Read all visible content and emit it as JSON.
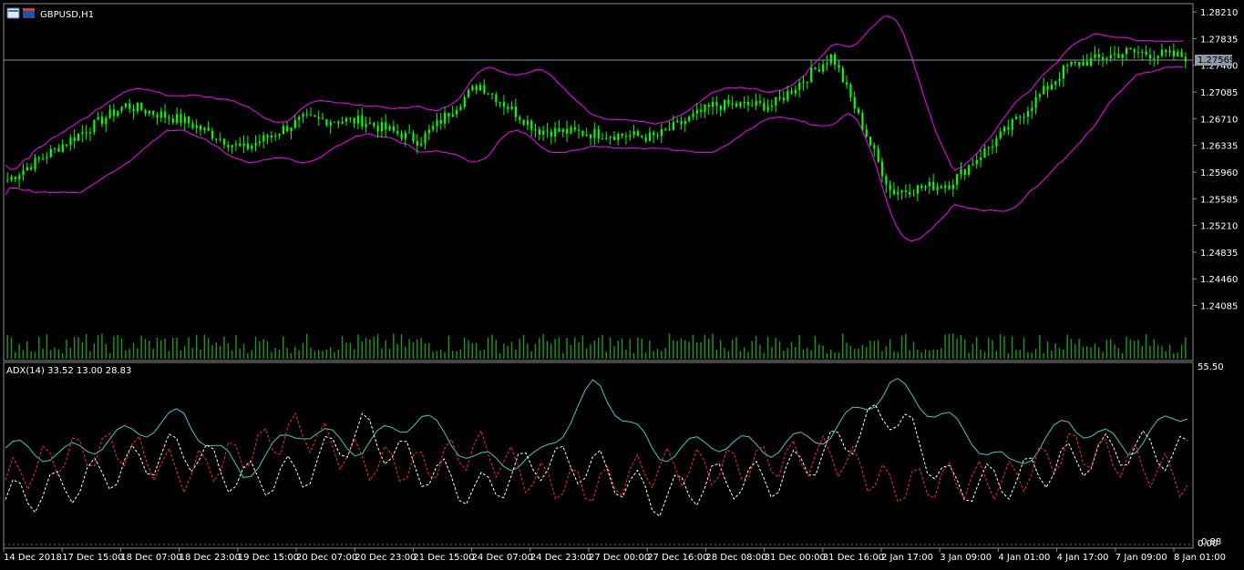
{
  "main_chart": {
    "symbol_label": "GBPUSD,H1",
    "current_price": "1.27569",
    "price_ticks": [
      "1.28210",
      "1.27835",
      "1.27460",
      "1.27085",
      "1.26710",
      "1.26335",
      "1.25960",
      "1.25585",
      "1.25210",
      "1.24835",
      "1.24460",
      "1.24085"
    ]
  },
  "indicator": {
    "label": "ADX(14) 33.52 13.00 28.83",
    "top_label": "55.50",
    "bottom_labels": [
      "0.00",
      "0.88"
    ]
  },
  "time_labels": [
    "14 Dec 2018",
    "17 Dec 15:00",
    "18 Dec 07:00",
    "18 Dec 23:00",
    "19 Dec 15:00",
    "20 Dec 07:00",
    "20 Dec 23:00",
    "21 Dec 15:00",
    "24 Dec 07:00",
    "24 Dec 23:00",
    "27 Dec 00:00",
    "27 Dec 16:00",
    "28 Dec 08:00",
    "31 Dec 00:00",
    "31 Dec 16:00",
    "2 Jan 17:00",
    "3 Jan 09:00",
    "4 Jan 01:00",
    "4 Jan 17:00",
    "7 Jan 09:00",
    "8 Jan 01:00"
  ],
  "colors": {
    "background": "#000000",
    "candle": "#00ff00",
    "bollinger": "#ff00ff",
    "volume": "#1a9a1a",
    "adx": "#40c8c8",
    "plus_di": "#ffffff",
    "minus_di": "#ff2a2a",
    "axis_text": "#ffffff",
    "price_label_bg": "#8c99a6"
  },
  "chart_data": {
    "type": "line",
    "title": "GBPUSD,H1",
    "ylim": [
      1.239,
      1.2825
    ],
    "x": [
      "14 Dec 2018",
      "17 Dec 15:00",
      "18 Dec 07:00",
      "18 Dec 23:00",
      "19 Dec 15:00",
      "20 Dec 07:00",
      "20 Dec 23:00",
      "21 Dec 15:00",
      "24 Dec 07:00",
      "24 Dec 23:00",
      "27 Dec 00:00",
      "27 Dec 16:00",
      "28 Dec 08:00",
      "31 Dec 00:00",
      "31 Dec 16:00",
      "2 Jan 17:00",
      "3 Jan 09:00",
      "4 Jan 01:00",
      "4 Jan 17:00",
      "7 Jan 09:00",
      "8 Jan 01:00"
    ],
    "series": [
      {
        "values": [
          1.2585,
          1.2638,
          1.269,
          1.2668,
          1.2628,
          1.267,
          1.2668,
          1.264,
          1.272,
          1.2655,
          1.265,
          1.2645,
          1.269,
          1.269,
          1.276,
          1.2568,
          1.258,
          1.2658,
          1.2745,
          1.2765,
          1.2758
        ]
      }
    ],
    "indicator_ylim": [
      0,
      55.5
    ],
    "indicator_series": [
      {
        "values": [
          30,
          28,
          34,
          40,
          22,
          36,
          30,
          40,
          26,
          26,
          50,
          28,
          32,
          30,
          35,
          50,
          38,
          24,
          38,
          30,
          42
        ]
      },
      {
        "values": [
          14,
          18,
          24,
          30,
          20,
          22,
          36,
          24,
          16,
          26,
          24,
          14,
          20,
          20,
          30,
          42,
          18,
          20,
          26,
          30,
          28
        ]
      },
      {
        "values": [
          20,
          28,
          30,
          22,
          28,
          36,
          26,
          24,
          30,
          20,
          18,
          24,
          24,
          26,
          28,
          18,
          20,
          20,
          30,
          26,
          20
        ]
      }
    ]
  }
}
